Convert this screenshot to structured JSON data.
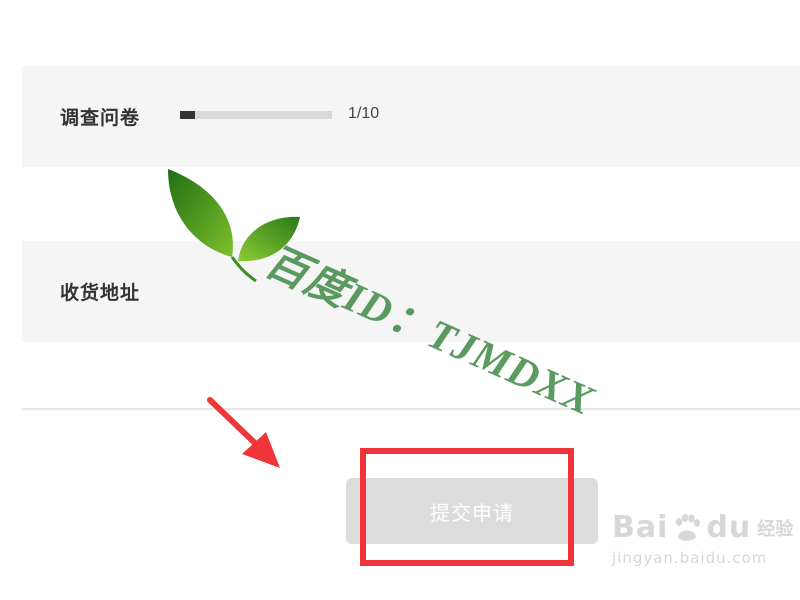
{
  "survey": {
    "label": "调查问卷",
    "progress_text": "1/10",
    "progress_fraction": 0.1
  },
  "address": {
    "label": "收货地址"
  },
  "submit": {
    "label": "提交申请"
  },
  "watermark": {
    "text": "百度ID：TJMDXX"
  },
  "baidu_logo": {
    "brand_left": "Bai",
    "brand_right": "du",
    "sub": "经验",
    "url": "jingyan.baidu.com"
  },
  "colors": {
    "highlight": "#f0353a",
    "row_background": "#f5f5f5",
    "button_disabled": "#dcdcdc",
    "watermark_green": "#3f8a45"
  },
  "icons": {
    "arrow": "red-arrow-icon",
    "logo": "green-leaf-icon",
    "paw": "baidu-paw-icon"
  }
}
